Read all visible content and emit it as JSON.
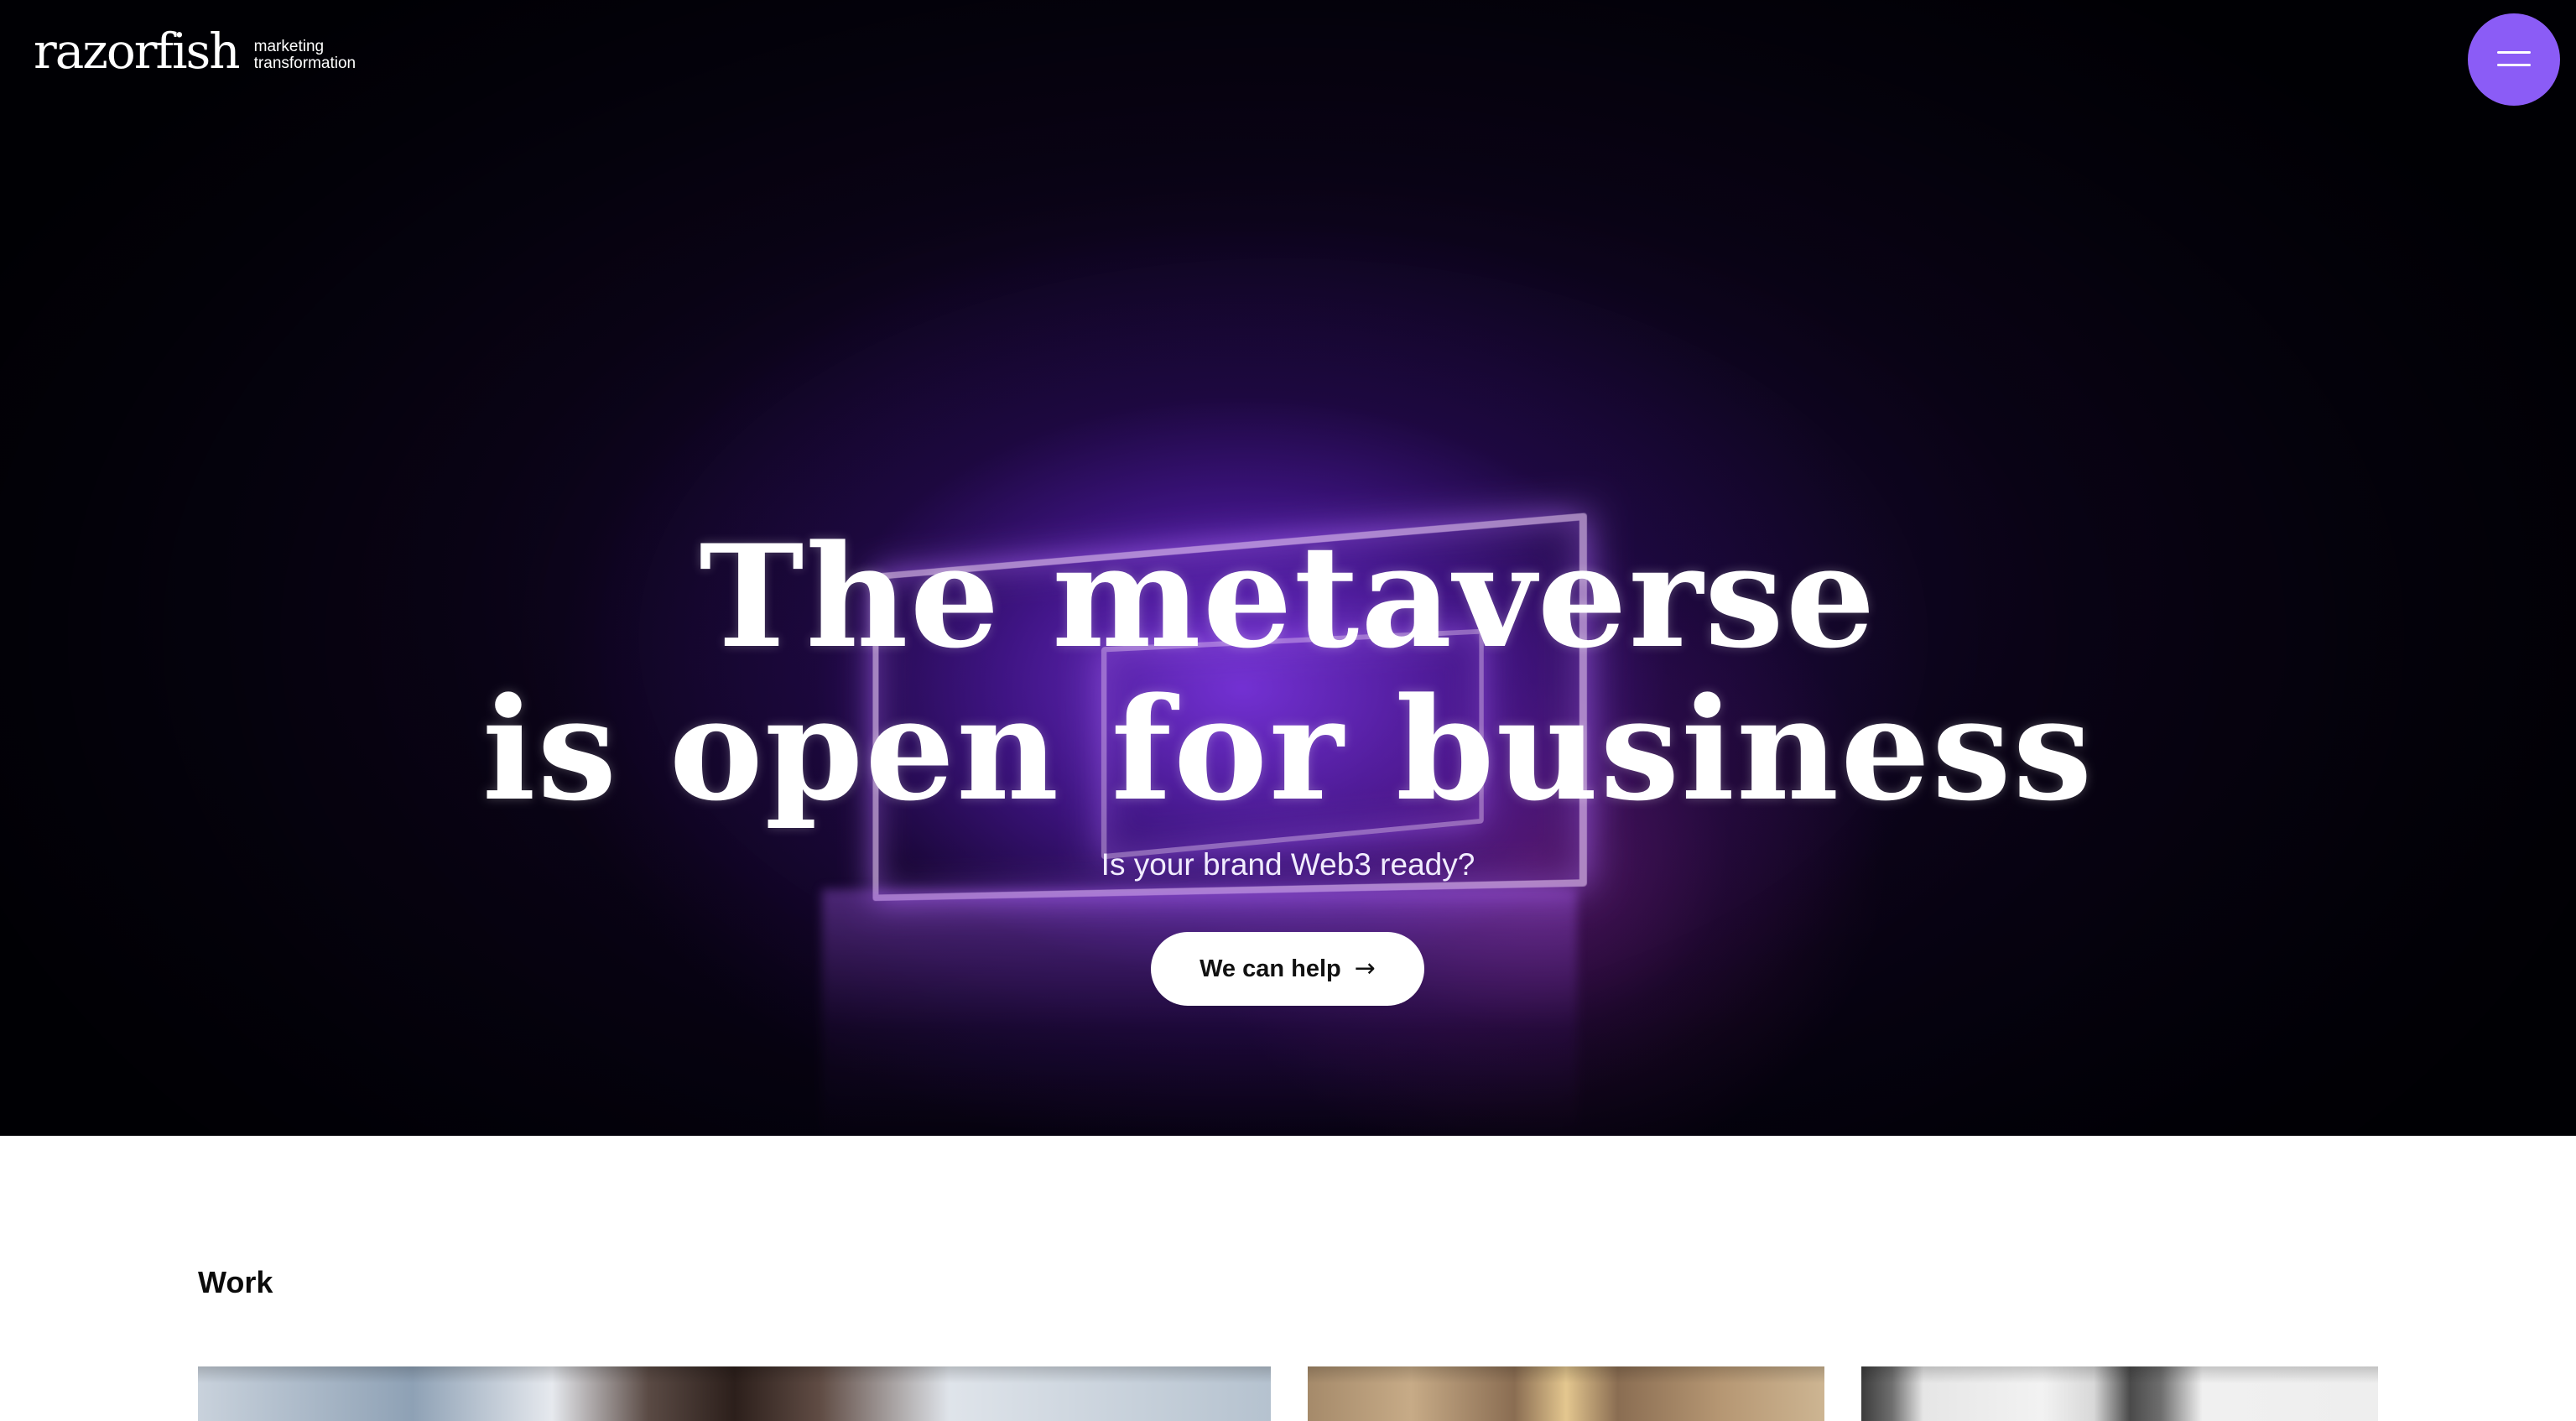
{
  "header": {
    "logo_text": "razorfish",
    "tagline_line1": "marketing",
    "tagline_line2": "transformation",
    "menu_button_color": "#8b5cf6"
  },
  "hero": {
    "headline_line1": "The metaverse",
    "headline_line2": "is open for business",
    "subheadline": "Is your brand Web3 ready?",
    "cta_label": "We can help",
    "cta_icon": "arrow-right-icon"
  },
  "work": {
    "title": "Work",
    "cards": [
      {
        "image": "portrait-photo"
      },
      {
        "image": "interior-chandelier-photo"
      },
      {
        "image": "architecture-photo"
      }
    ]
  },
  "colors": {
    "accent": "#8b5cf6",
    "hero_background": "#02010a",
    "page_background": "#ffffff"
  }
}
